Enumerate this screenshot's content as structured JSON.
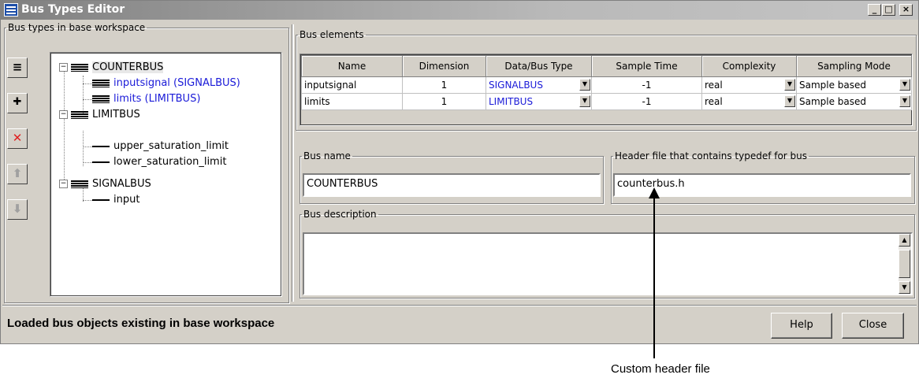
{
  "window": {
    "title": "Bus Types Editor",
    "controls": [
      "_",
      "□",
      "×"
    ]
  },
  "left_panel": {
    "legend": "Bus types in base workspace",
    "toolbar": [
      {
        "name": "new-bus-icon",
        "glyph": "≡",
        "enabled": true
      },
      {
        "name": "insert-element-icon",
        "glyph": "✚",
        "enabled": true
      },
      {
        "name": "delete-icon",
        "glyph": "✕",
        "enabled": true
      },
      {
        "name": "move-up-icon",
        "glyph": "⬆",
        "enabled": false
      },
      {
        "name": "move-down-icon",
        "glyph": "⬇",
        "enabled": false
      }
    ],
    "tree": [
      {
        "label": "COUNTERBUS",
        "type": "bus",
        "level": 0,
        "expander": "−",
        "selected": true
      },
      {
        "label": "inputsignal  (SIGNALBUS)",
        "type": "bus",
        "level": 1,
        "link": true
      },
      {
        "label": "limits  (LIMITBUS)",
        "type": "bus",
        "level": 1,
        "link": true
      },
      {
        "label": "LIMITBUS",
        "type": "bus",
        "level": 0,
        "expander": "−"
      },
      {
        "label": "upper_saturation_limit",
        "type": "signal",
        "level": 1
      },
      {
        "label": "lower_saturation_limit",
        "type": "signal",
        "level": 1
      },
      {
        "label": "SIGNALBUS",
        "type": "bus",
        "level": 0,
        "expander": "−"
      },
      {
        "label": "input",
        "type": "signal",
        "level": 1
      }
    ]
  },
  "bus_elements": {
    "legend": "Bus elements",
    "columns": [
      "Name",
      "Dimension",
      "Data/Bus Type",
      "Sample Time",
      "Complexity",
      "Sampling Mode"
    ],
    "rows": [
      {
        "name": "inputsignal",
        "dimension": "1",
        "type": "SIGNALBUS",
        "sample_time": "-1",
        "complexity": "real",
        "mode": "Sample based"
      },
      {
        "name": "limits",
        "dimension": "1",
        "type": "LIMITBUS",
        "sample_time": "-1",
        "complexity": "real",
        "mode": "Sample based"
      }
    ]
  },
  "bus_name": {
    "legend": "Bus name",
    "value": "COUNTERBUS"
  },
  "header_file": {
    "legend": "Header file that contains typedef for bus",
    "value": "counterbus.h"
  },
  "bus_description": {
    "legend": "Bus description",
    "value": ""
  },
  "status_text": "Loaded bus objects existing in base workspace",
  "buttons": {
    "help": "Help",
    "close": "Close"
  },
  "annotation": "Custom header file",
  "colors": {
    "link": "#1a1ad8",
    "face": "#d4d0c8",
    "delete": "#e02020"
  }
}
